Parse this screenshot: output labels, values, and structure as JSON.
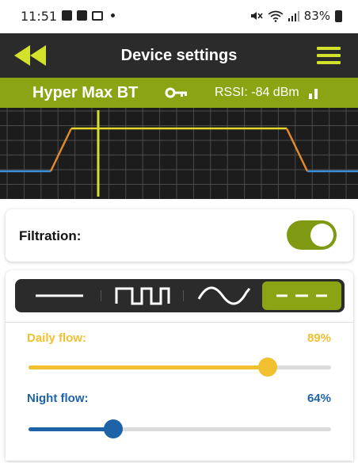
{
  "status_bar": {
    "time": "11:51",
    "battery": "83%",
    "icons": [
      "image-icon",
      "check-square-icon",
      "mail-icon",
      "dot-icon",
      "mute-icon",
      "wifi-icon",
      "signal-icon",
      "battery-icon"
    ]
  },
  "appbar": {
    "title": "Device settings",
    "back_icon": "double-chevron-left-icon",
    "menu_icon": "hamburger-menu-icon",
    "accent": "#d4e12a"
  },
  "device": {
    "name": "Hyper Max BT",
    "key_icon": "key-icon",
    "rssi": "RSSI: -84 dBm",
    "signal_icon": "signal-bars-icon",
    "bar_color": "#8aa414"
  },
  "filtration": {
    "label": "Filtration:",
    "enabled": true
  },
  "modes": {
    "items": [
      {
        "name": "constant-mode-icon",
        "active": false
      },
      {
        "name": "square-wave-mode-icon",
        "active": false
      },
      {
        "name": "sine-wave-mode-icon",
        "active": false
      },
      {
        "name": "dashed-mode-icon",
        "active": true
      }
    ]
  },
  "daily_flow": {
    "label": "Daily flow:",
    "value": "89%",
    "level": 0.79,
    "color": "#f0c030"
  },
  "night_flow": {
    "label": "Night flow:",
    "value": "64%",
    "level": 0.28,
    "color": "#1e63a8"
  }
}
